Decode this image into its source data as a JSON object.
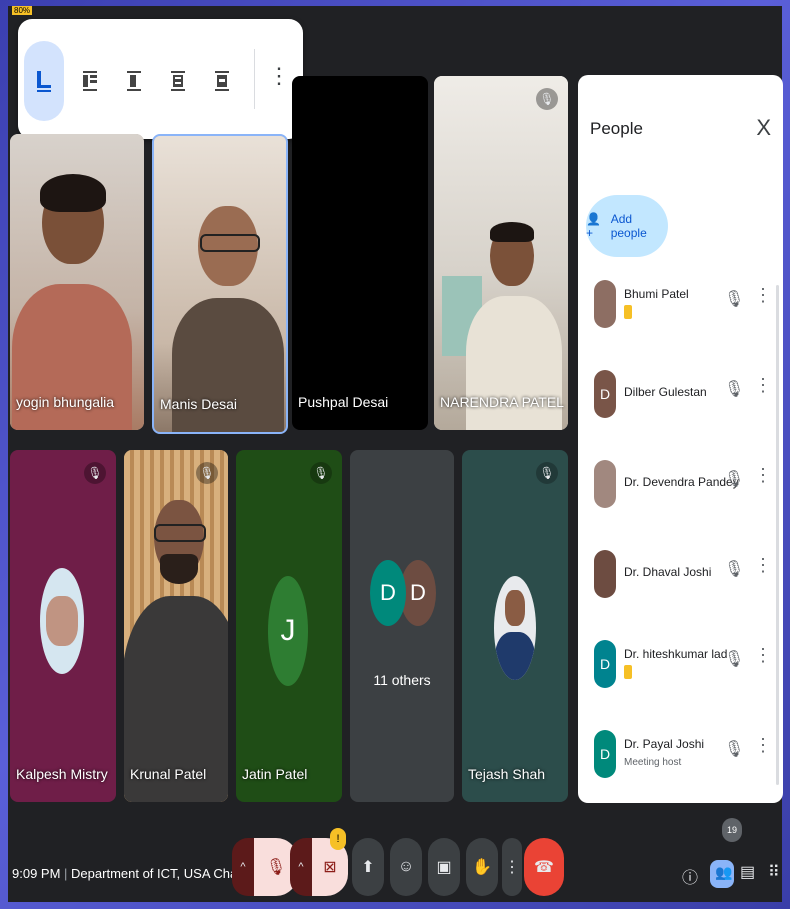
{
  "percent_badge": "80%",
  "layout_toolbar": {
    "options": [
      "auto-layout",
      "tiled",
      "spotlight",
      "sidebar",
      "sidebar-right"
    ],
    "selected_index": 0
  },
  "tiles": [
    {
      "id": "yogin",
      "name": "yogin bhungalia",
      "muted": false
    },
    {
      "id": "manis",
      "name": "Manis Desai",
      "muted": false
    },
    {
      "id": "pushpal",
      "name": "Pushpal Desai",
      "muted": false
    },
    {
      "id": "narendra",
      "name": "NARENDRA PATEL",
      "muted": true
    },
    {
      "id": "kalpesh",
      "name": "Kalpesh Mistry",
      "muted": true
    },
    {
      "id": "krunal",
      "name": "Krunal Patel",
      "muted": true
    },
    {
      "id": "jatin",
      "name": "Jatin Patel",
      "muted": true,
      "initial": "J"
    },
    {
      "id": "others",
      "name": "11 others",
      "initials": [
        "D",
        "D"
      ]
    },
    {
      "id": "tejash",
      "name": "Tejash Shah",
      "muted": true
    }
  ],
  "people_panel": {
    "title": "People",
    "close": "X",
    "add_people": "Add people",
    "participants": [
      {
        "name": "Bhumi Patel",
        "sub": "",
        "badge": true,
        "avatar_color": "#8d6e63",
        "initial": ""
      },
      {
        "name": "Dilber Gulestan",
        "sub": "",
        "badge": false,
        "avatar_color": "#795548",
        "initial": "D"
      },
      {
        "name": "Dr. Devendra Pandey",
        "sub": "",
        "badge": false,
        "avatar_color": "#a1887f",
        "initial": ""
      },
      {
        "name": "Dr. Dhaval Joshi",
        "sub": "",
        "badge": false,
        "avatar_color": "#6d4c41",
        "initial": ""
      },
      {
        "name": "Dr. hiteshkumar lad",
        "sub": "",
        "badge": true,
        "avatar_color": "#00838f",
        "initial": "D"
      },
      {
        "name": "Dr. Payal Joshi",
        "sub": "Meeting host",
        "badge": false,
        "avatar_color": "#00897b",
        "initial": "D"
      }
    ]
  },
  "bottom_bar": {
    "clock": "9:09 PM",
    "meeting_title": "Department of ICT, USA Chapter, ...",
    "people_count": "19",
    "alert_badge": "!"
  },
  "colors": {
    "end_call": "#ea4335",
    "muted_red": "#f9dedc",
    "accent": "#0b57d0"
  }
}
